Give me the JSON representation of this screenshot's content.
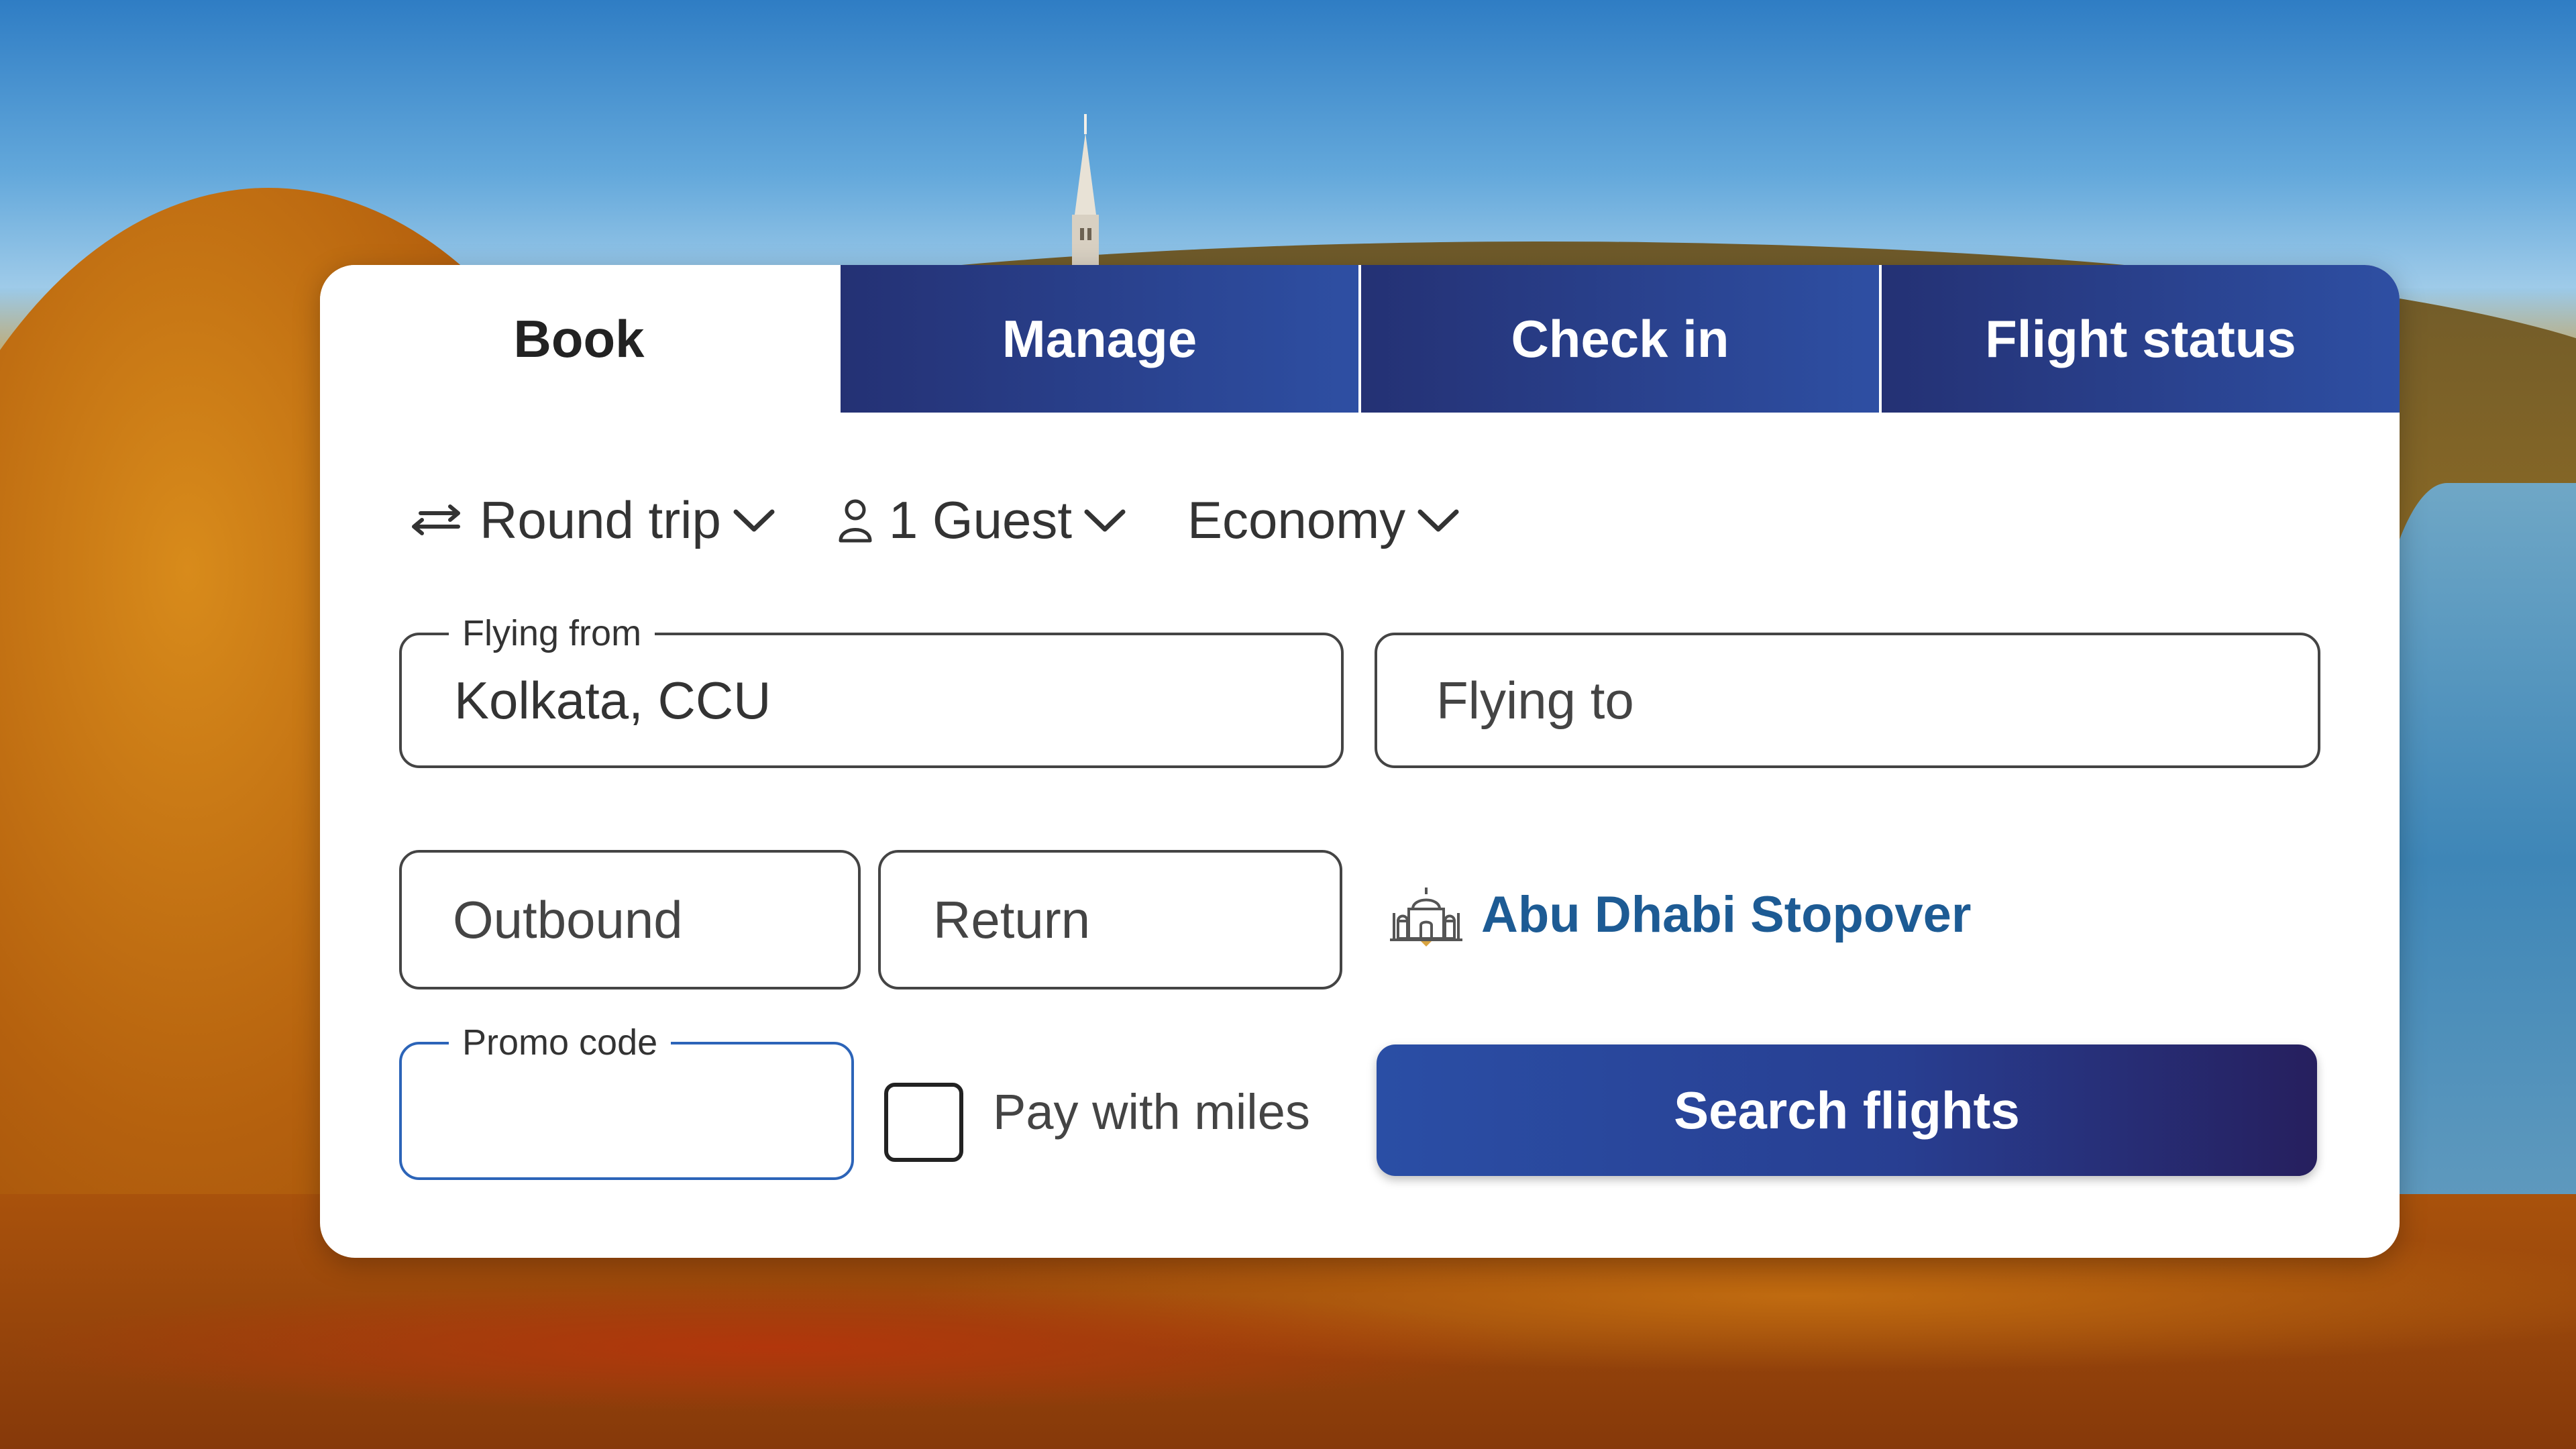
{
  "tabs": [
    {
      "label": "Book",
      "active": true
    },
    {
      "label": "Manage",
      "active": false
    },
    {
      "label": "Check in",
      "active": false
    },
    {
      "label": "Flight status",
      "active": false
    }
  ],
  "options": {
    "trip_type": {
      "label": "Round trip",
      "icon": "swap-arrows-icon"
    },
    "guests": {
      "label": "1 Guest",
      "icon": "person-icon"
    },
    "cabin": {
      "label": "Economy"
    }
  },
  "fields": {
    "flying_from": {
      "legend": "Flying from",
      "value": "Kolkata, CCU"
    },
    "flying_to": {
      "placeholder": "Flying to"
    },
    "outbound": {
      "placeholder": "Outbound"
    },
    "return": {
      "placeholder": "Return"
    },
    "promo_code": {
      "legend": "Promo code",
      "value": ""
    }
  },
  "stopover": {
    "label": "Abu Dhabi Stopover",
    "icon": "mosque-icon",
    "color": "#1d5b94"
  },
  "pay_with_miles": {
    "label": "Pay with miles",
    "checked": false
  },
  "search_button": {
    "label": "Search flights"
  },
  "colors": {
    "tab_bg_start": "#243174",
    "tab_bg_end": "#2e4fa3",
    "button_start": "#2a4ea5",
    "button_end": "#261f5e",
    "promo_border": "#2c64b8"
  }
}
